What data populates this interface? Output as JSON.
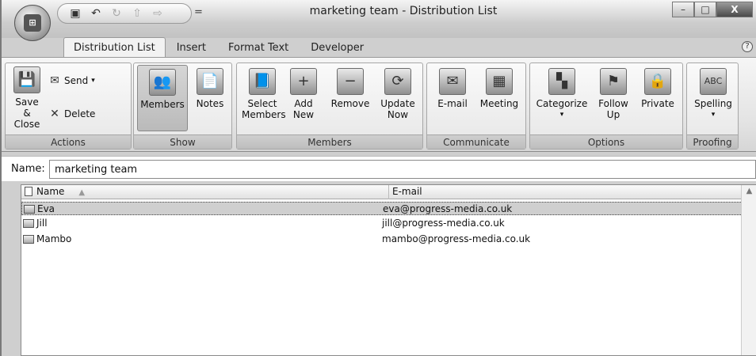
{
  "window": {
    "title": "marketing team - Distribution List"
  },
  "office_button": {
    "label": "Office"
  },
  "quick_access": {
    "more": "="
  },
  "window_controls": {
    "minimize": "–",
    "maximize": "□",
    "close": "X"
  },
  "help": {
    "label": "?"
  },
  "tabs": [
    {
      "label": "Distribution List"
    },
    {
      "label": "Insert"
    },
    {
      "label": "Format Text"
    },
    {
      "label": "Developer"
    }
  ],
  "ribbon": {
    "actions": {
      "save_close": "Save &\nClose",
      "send": "Send",
      "delete": "Delete",
      "label": "Actions"
    },
    "show": {
      "members": "Members",
      "notes": "Notes",
      "label": "Show"
    },
    "members": {
      "select": "Select\nMembers",
      "add": "Add\nNew",
      "remove": "Remove",
      "update": "Update\nNow",
      "label": "Members"
    },
    "communicate": {
      "email": "E-mail",
      "meeting": "Meeting",
      "label": "Communicate"
    },
    "options": {
      "categorize": "Categorize",
      "follow_up": "Follow\nUp",
      "private": "Private",
      "label": "Options"
    },
    "proofing": {
      "spelling": "Spelling",
      "label": "Proofing"
    }
  },
  "name_field": {
    "label": "Name:",
    "value": "marketing team"
  },
  "list": {
    "columns": [
      "Name",
      "E-mail"
    ],
    "rows": [
      {
        "name": "Eva",
        "email": "eva@progress-media.co.uk",
        "selected": true
      },
      {
        "name": "Jill",
        "email": "jill@progress-media.co.uk",
        "selected": false
      },
      {
        "name": "Mambo",
        "email": "mambo@progress-media.co.uk",
        "selected": false
      }
    ]
  }
}
